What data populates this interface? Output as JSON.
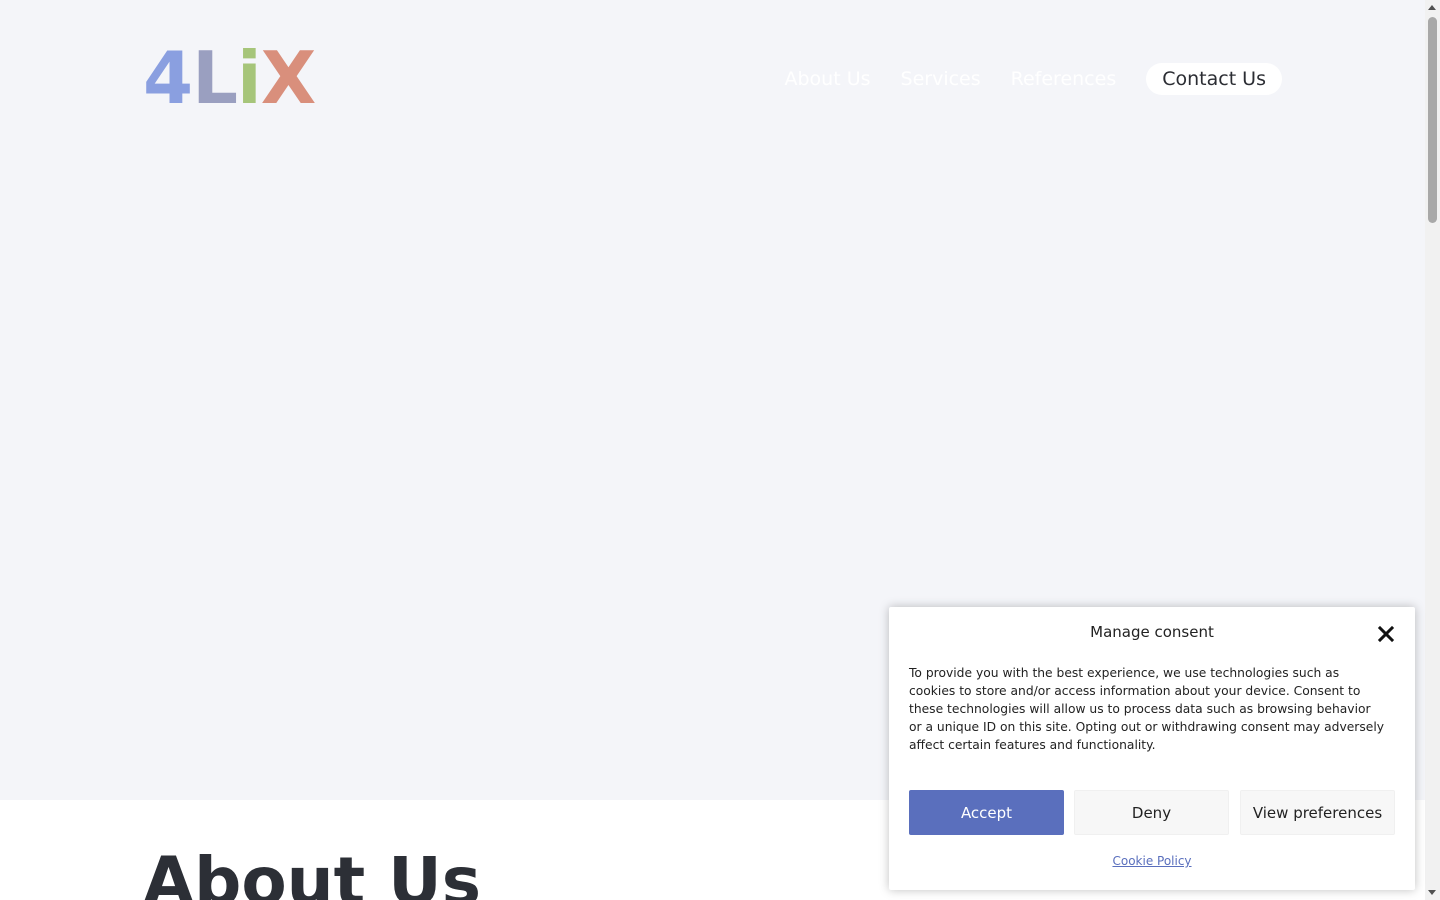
{
  "header": {
    "logo": {
      "chars": [
        {
          "char": "4",
          "color": "#8a9fe0"
        },
        {
          "char": "L",
          "color": "#9a9fc0"
        },
        {
          "char": "i",
          "color": "#a6c57a"
        },
        {
          "char": "X",
          "color": "#d98f7c"
        }
      ]
    },
    "nav": {
      "about": "About Us",
      "services": "Services",
      "references": "References",
      "contact": "Contact Us"
    }
  },
  "main": {
    "about_title": "About Us"
  },
  "consent": {
    "title": "Manage consent",
    "close_icon": "close-icon",
    "text": "To provide you with the best experience, we use technologies such as cookies to store and/or access information about your device. Consent to these technologies will allow us to process data such as browsing behavior or a unique ID on this site. Opting out or withdrawing consent may adversely affect certain features and functionality.",
    "accept_label": "Accept",
    "deny_label": "Deny",
    "preferences_label": "View preferences",
    "cookie_policy_label": "Cookie Policy",
    "accent_color": "#5a6fbd"
  }
}
